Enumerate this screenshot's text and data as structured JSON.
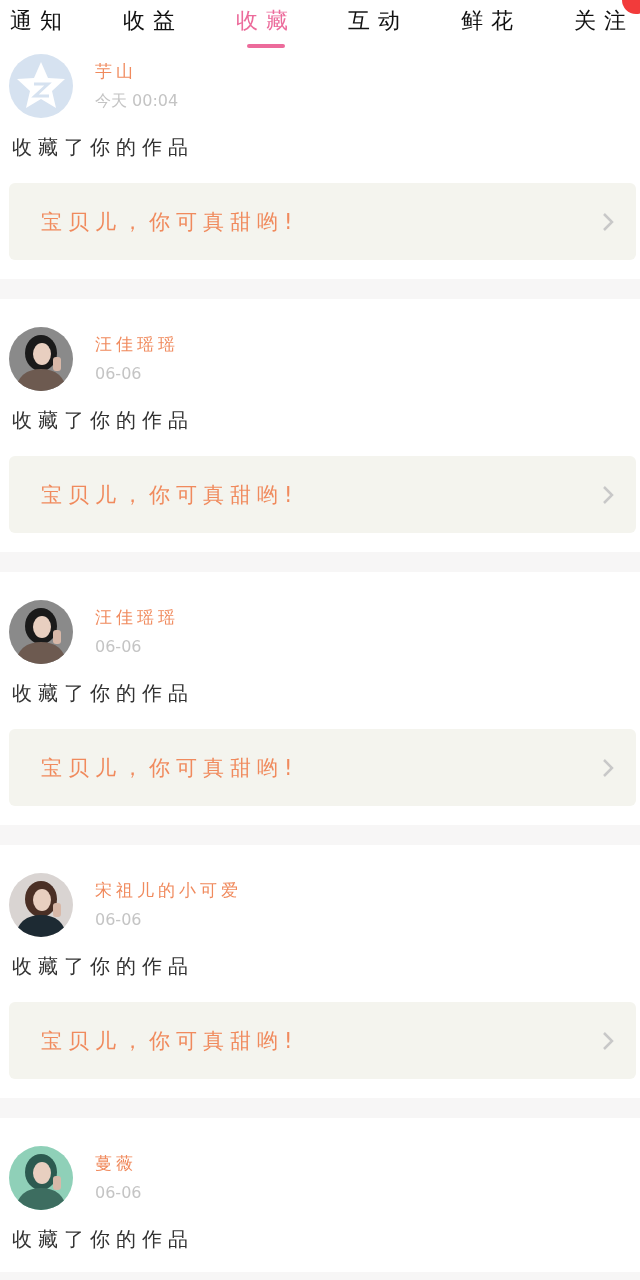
{
  "tabs": [
    {
      "label": "通知",
      "selected": false
    },
    {
      "label": "收益",
      "selected": false
    },
    {
      "label": "收藏",
      "selected": true
    },
    {
      "label": "互动",
      "selected": false
    },
    {
      "label": "鲜花",
      "selected": false
    },
    {
      "label": "关注",
      "selected": false
    }
  ],
  "notifications": [
    {
      "avatar": {
        "kind": "default"
      },
      "name": "芋山",
      "time": "今天 00:04",
      "action": "收藏了你的作品",
      "work": "宝贝儿，你可真甜哟!"
    },
    {
      "name": "汪佳瑶瑶",
      "time": "06-06",
      "action": "收藏了你的作品",
      "work": "宝贝儿，你可真甜哟!"
    },
    {
      "name": "汪佳瑶瑶",
      "time": "06-06",
      "action": "收藏了你的作品",
      "work": "宝贝儿，你可真甜哟!"
    },
    {
      "name": "宋祖儿的小可爱",
      "time": "06-06",
      "action": "收藏了你的作品",
      "work": "宝贝儿，你可真甜哟!"
    },
    {
      "name": "蔓薇",
      "time": "06-06",
      "action": "收藏了你的作品"
    }
  ]
}
